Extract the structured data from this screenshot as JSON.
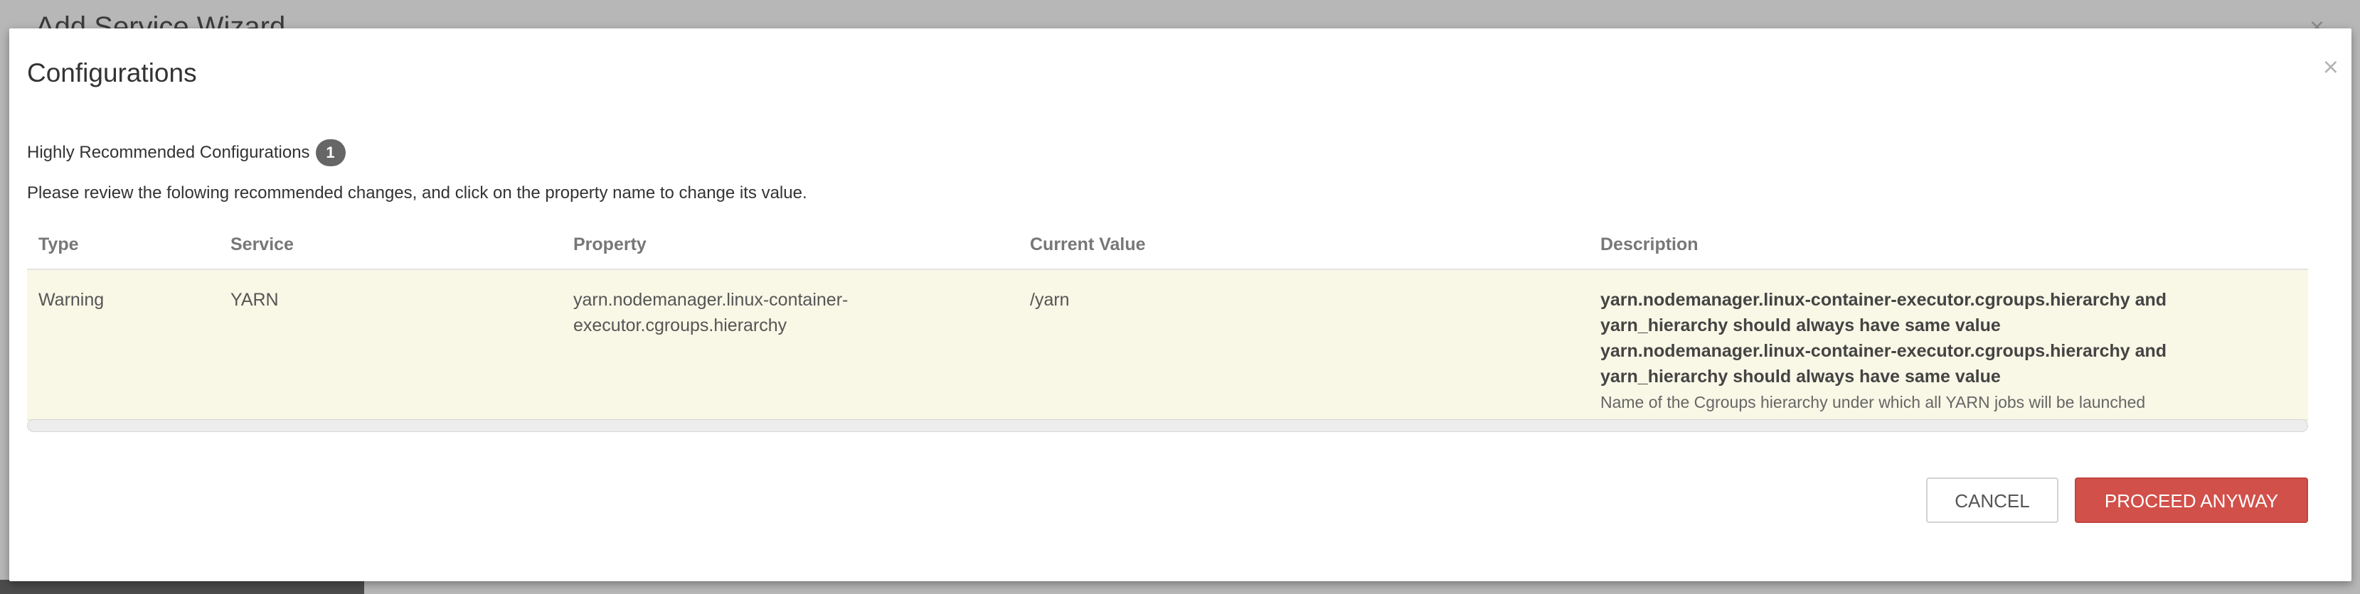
{
  "background": {
    "wizard_title": "Add Service Wizard",
    "close_symbol": "×"
  },
  "modal": {
    "title": "Configurations",
    "close_symbol": "×",
    "section_label": "Highly Recommended Configurations",
    "section_count": "1",
    "instructions": "Please review the folowing recommended changes, and click on the property name to change its value."
  },
  "table": {
    "headers": {
      "type": "Type",
      "service": "Service",
      "property": "Property",
      "current_value": "Current Value",
      "description": "Description"
    },
    "rows": [
      {
        "type": "Warning",
        "service": "YARN",
        "property": "yarn.nodemanager.linux-container-executor.cgroups.hierarchy",
        "current_value": "/yarn",
        "messages": [
          "yarn.nodemanager.linux-container-executor.cgroups.hierarchy and yarn_hierarchy should always have same value",
          "yarn.nodemanager.linux-container-executor.cgroups.hierarchy and yarn_hierarchy should always have same value"
        ],
        "description": "Name of the Cgroups hierarchy under which all YARN jobs will be launched"
      }
    ]
  },
  "footer": {
    "cancel_label": "CANCEL",
    "proceed_label": "PROCEED ANYWAY"
  },
  "colors": {
    "warning_row_bg": "#f9f7e6",
    "proceed_button": "#d2504a",
    "badge_bg": "#666666"
  }
}
